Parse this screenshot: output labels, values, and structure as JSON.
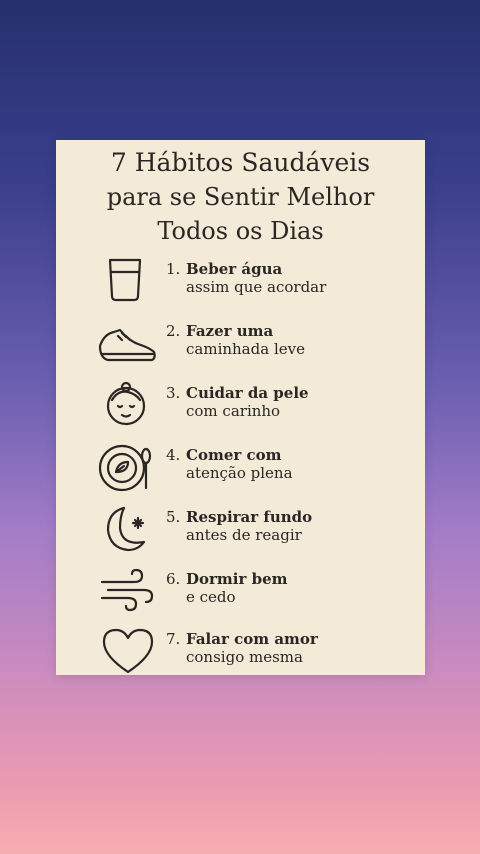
{
  "card": {
    "title_line1": "7 Hábitos Saudáveis",
    "title_line2": "para se Sentir Melhor",
    "title_line3": "Todos os Dias"
  },
  "habits": [
    {
      "number": "1.",
      "line1": "Beber água",
      "line2": "assim que acordar",
      "icon": "glass-icon"
    },
    {
      "number": "2.",
      "line1": "Fazer uma",
      "line2": "caminhada leve",
      "icon": "sneaker-icon"
    },
    {
      "number": "3.",
      "line1": "Cuidar da pele",
      "line2": "com carinho",
      "icon": "face-icon"
    },
    {
      "number": "4.",
      "line1": "Comer com",
      "line2": "atenção plena",
      "icon": "plate-icon"
    },
    {
      "number": "5.",
      "line1": "Respirar fundo",
      "line2": "antes de reagir",
      "icon": "moon-icon"
    },
    {
      "number": "6.",
      "line1": "Dormir bem",
      "line2": "e cedo",
      "icon": "wind-icon"
    },
    {
      "number": "7.",
      "line1": "Falar com amor",
      "line2": "consigo mesma",
      "icon": "heart-icon"
    }
  ]
}
